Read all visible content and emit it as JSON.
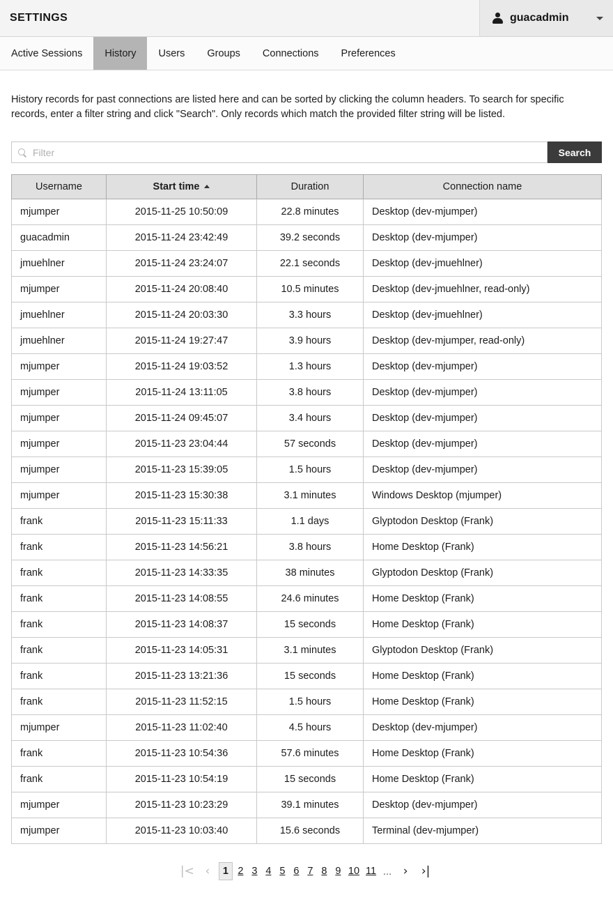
{
  "header": {
    "title": "SETTINGS",
    "user": {
      "name": "guacadmin",
      "icon": "user-icon",
      "caret": "chevron-down-icon"
    }
  },
  "tabs": [
    {
      "label": "Active Sessions",
      "active": false
    },
    {
      "label": "History",
      "active": true
    },
    {
      "label": "Users",
      "active": false
    },
    {
      "label": "Groups",
      "active": false
    },
    {
      "label": "Connections",
      "active": false
    },
    {
      "label": "Preferences",
      "active": false
    }
  ],
  "description": "History records for past connections are listed here and can be sorted by clicking the column headers. To search for specific records, enter a filter string and click \"Search\". Only records which match the provided filter string will be listed.",
  "search": {
    "icon": "search-icon",
    "placeholder": "Filter",
    "value": "",
    "button_label": "Search"
  },
  "table": {
    "columns": [
      {
        "label": "Username",
        "sorted": false,
        "align": "left"
      },
      {
        "label": "Start time",
        "sorted": true,
        "align": "center",
        "sort_direction": "asc"
      },
      {
        "label": "Duration",
        "sorted": false,
        "align": "center"
      },
      {
        "label": "Connection name",
        "sorted": false,
        "align": "left"
      }
    ],
    "rows": [
      {
        "username": "mjumper",
        "start_time": "2015-11-25 10:50:09",
        "duration": "22.8 minutes",
        "connection": "Desktop (dev-mjumper)"
      },
      {
        "username": "guacadmin",
        "start_time": "2015-11-24 23:42:49",
        "duration": "39.2 seconds",
        "connection": "Desktop (dev-mjumper)"
      },
      {
        "username": "jmuehlner",
        "start_time": "2015-11-24 23:24:07",
        "duration": "22.1 seconds",
        "connection": "Desktop (dev-jmuehlner)"
      },
      {
        "username": "mjumper",
        "start_time": "2015-11-24 20:08:40",
        "duration": "10.5 minutes",
        "connection": "Desktop (dev-jmuehlner, read-only)"
      },
      {
        "username": "jmuehlner",
        "start_time": "2015-11-24 20:03:30",
        "duration": "3.3 hours",
        "connection": "Desktop (dev-jmuehlner)"
      },
      {
        "username": "jmuehlner",
        "start_time": "2015-11-24 19:27:47",
        "duration": "3.9 hours",
        "connection": "Desktop (dev-mjumper, read-only)"
      },
      {
        "username": "mjumper",
        "start_time": "2015-11-24 19:03:52",
        "duration": "1.3 hours",
        "connection": "Desktop (dev-mjumper)"
      },
      {
        "username": "mjumper",
        "start_time": "2015-11-24 13:11:05",
        "duration": "3.8 hours",
        "connection": "Desktop (dev-mjumper)"
      },
      {
        "username": "mjumper",
        "start_time": "2015-11-24 09:45:07",
        "duration": "3.4 hours",
        "connection": "Desktop (dev-mjumper)"
      },
      {
        "username": "mjumper",
        "start_time": "2015-11-23 23:04:44",
        "duration": "57 seconds",
        "connection": "Desktop (dev-mjumper)"
      },
      {
        "username": "mjumper",
        "start_time": "2015-11-23 15:39:05",
        "duration": "1.5 hours",
        "connection": "Desktop (dev-mjumper)"
      },
      {
        "username": "mjumper",
        "start_time": "2015-11-23 15:30:38",
        "duration": "3.1 minutes",
        "connection": "Windows Desktop (mjumper)"
      },
      {
        "username": "frank",
        "start_time": "2015-11-23 15:11:33",
        "duration": "1.1 days",
        "connection": "Glyptodon Desktop (Frank)"
      },
      {
        "username": "frank",
        "start_time": "2015-11-23 14:56:21",
        "duration": "3.8 hours",
        "connection": "Home Desktop (Frank)"
      },
      {
        "username": "frank",
        "start_time": "2015-11-23 14:33:35",
        "duration": "38 minutes",
        "connection": "Glyptodon Desktop (Frank)"
      },
      {
        "username": "frank",
        "start_time": "2015-11-23 14:08:55",
        "duration": "24.6 minutes",
        "connection": "Home Desktop (Frank)"
      },
      {
        "username": "frank",
        "start_time": "2015-11-23 14:08:37",
        "duration": "15 seconds",
        "connection": "Home Desktop (Frank)"
      },
      {
        "username": "frank",
        "start_time": "2015-11-23 14:05:31",
        "duration": "3.1 minutes",
        "connection": "Glyptodon Desktop (Frank)"
      },
      {
        "username": "frank",
        "start_time": "2015-11-23 13:21:36",
        "duration": "15 seconds",
        "connection": "Home Desktop (Frank)"
      },
      {
        "username": "frank",
        "start_time": "2015-11-23 11:52:15",
        "duration": "1.5 hours",
        "connection": "Home Desktop (Frank)"
      },
      {
        "username": "mjumper",
        "start_time": "2015-11-23 11:02:40",
        "duration": "4.5 hours",
        "connection": "Desktop (dev-mjumper)"
      },
      {
        "username": "frank",
        "start_time": "2015-11-23 10:54:36",
        "duration": "57.6 minutes",
        "connection": "Home Desktop (Frank)"
      },
      {
        "username": "frank",
        "start_time": "2015-11-23 10:54:19",
        "duration": "15 seconds",
        "connection": "Home Desktop (Frank)"
      },
      {
        "username": "mjumper",
        "start_time": "2015-11-23 10:23:29",
        "duration": "39.1 minutes",
        "connection": "Desktop (dev-mjumper)"
      },
      {
        "username": "mjumper",
        "start_time": "2015-11-23 10:03:40",
        "duration": "15.6 seconds",
        "connection": "Terminal (dev-mjumper)"
      }
    ]
  },
  "pagination": {
    "first_label": "|<",
    "prev_label": "‹",
    "next_label": "›",
    "last_label": "›|",
    "ellipsis": "...",
    "current_page": 1,
    "pages": [
      1,
      2,
      3,
      4,
      5,
      6,
      7,
      8,
      9,
      10,
      11
    ]
  },
  "colors": {
    "header_bg": "#f4f4f4",
    "user_menu_bg": "#e9e9e9",
    "active_tab_bg": "#b4b4b4",
    "table_header_bg": "#e0e0e0",
    "search_button_bg": "#3b3b3b",
    "text": "#1c1c1c"
  }
}
